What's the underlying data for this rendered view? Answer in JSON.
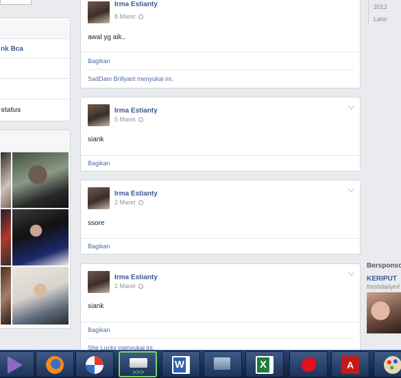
{
  "left": {
    "rows": [
      "nk Bca",
      "status"
    ]
  },
  "right": {
    "year": "2012",
    "lahir": "Lahir",
    "sponsored": "Bersponsc",
    "ad_title": "KERIPUT",
    "ad_sub": "freshdailyinf"
  },
  "posts": [
    {
      "name": "Irma Estianty",
      "date": "8 Maret",
      "text": "awal yg aik..",
      "share": "Bagikan",
      "likes": "SadDam Brillyant menyukai ini."
    },
    {
      "name": "Irma Estianty",
      "date": "5 Maret",
      "text": "siank",
      "share": "Bagikan"
    },
    {
      "name": "Irma Estianty",
      "date": "2 Maret",
      "text": "ssore",
      "share": "Bagikan"
    },
    {
      "name": "Irma Estianty",
      "date": "2 Maret",
      "text": "siank",
      "share": "Bagikan",
      "likes": "She Lucky menyukai ini."
    }
  ],
  "taskbar": {
    "icons": [
      "visual-studio-icon",
      "firefox-icon",
      "browser-icon",
      "app-green-icon",
      "word-icon",
      "network-icon",
      "excel-icon",
      "paint-splat-icon",
      "acrobat-icon",
      "paint-palette-icon"
    ]
  }
}
